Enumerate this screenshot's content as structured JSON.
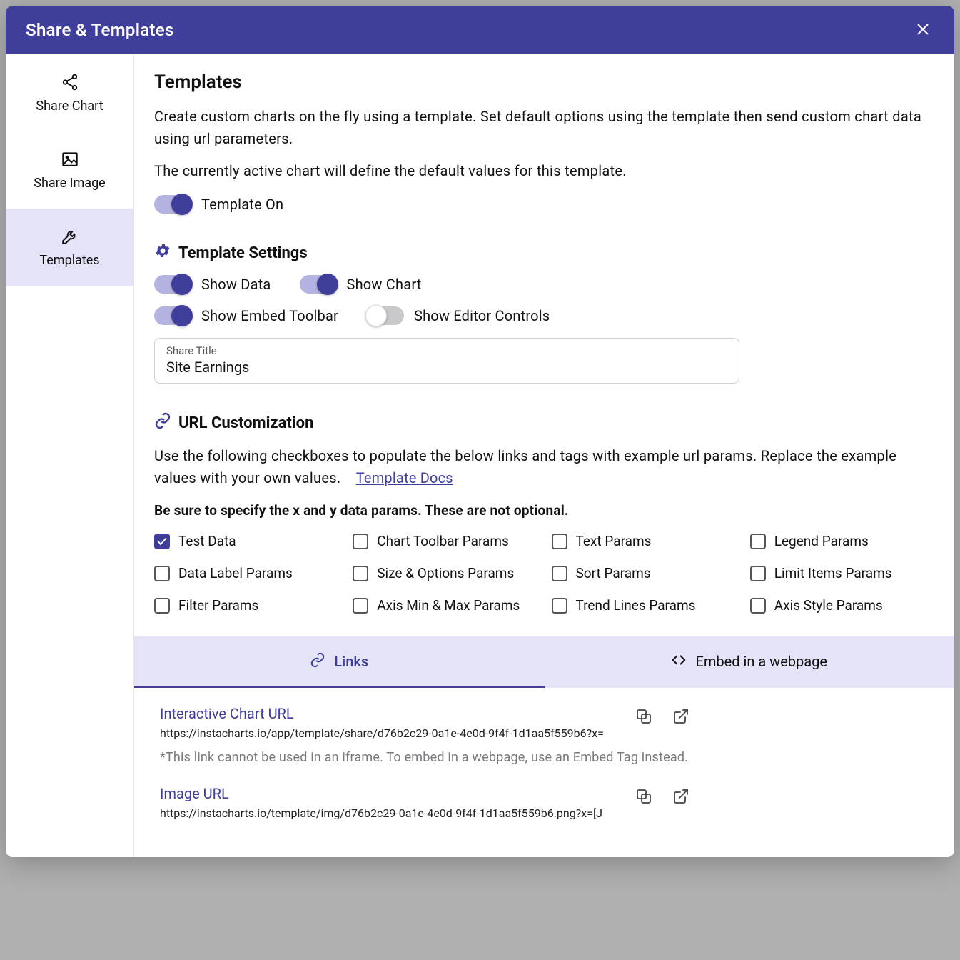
{
  "header": {
    "title": "Share & Templates"
  },
  "sidebar": {
    "items": [
      {
        "label": "Share Chart"
      },
      {
        "label": "Share Image"
      },
      {
        "label": "Templates"
      }
    ]
  },
  "templates": {
    "heading": "Templates",
    "desc1": "Create custom charts on the fly using a template. Set default options using the template then send custom chart data using url parameters.",
    "desc2": "The currently active chart will define the default values for this template.",
    "toggle_on_label": "Template On"
  },
  "settings": {
    "heading": "Template Settings",
    "toggles": {
      "show_data": "Show Data",
      "show_chart": "Show Chart",
      "show_embed_toolbar": "Show Embed Toolbar",
      "show_editor_controls": "Show Editor Controls"
    },
    "share_title_label": "Share Title",
    "share_title_value": "Site Earnings"
  },
  "url": {
    "heading": "URL Customization",
    "desc": "Use the following checkboxes to populate the below links and tags with example url params. Replace the example values with your own values.",
    "docs_link": "Template Docs",
    "bold_note": "Be sure to specify the x and y data params. These are not optional.",
    "checkboxes": [
      "Test Data",
      "Chart Toolbar Params",
      "Text Params",
      "Legend Params",
      "Data Label Params",
      "Size & Options Params",
      "Sort Params",
      "Limit Items Params",
      "Filter Params",
      "Axis Min & Max Params",
      "Trend Lines Params",
      "Axis Style Params"
    ]
  },
  "tabs": {
    "links": "Links",
    "embed": "Embed in a webpage"
  },
  "links": {
    "interactive": {
      "title": "Interactive Chart URL",
      "url": "https://instacharts.io/app/template/share/d76b2c29-0a1e-4e0d-9f4f-1d1aa5f559b6?x=",
      "note": "*This link cannot be used in an iframe. To embed in a webpage, use an Embed Tag instead."
    },
    "image": {
      "title": "Image URL",
      "url": "https://instacharts.io/template/img/d76b2c29-0a1e-4e0d-9f4f-1d1aa5f559b6.png?x=[J"
    }
  }
}
